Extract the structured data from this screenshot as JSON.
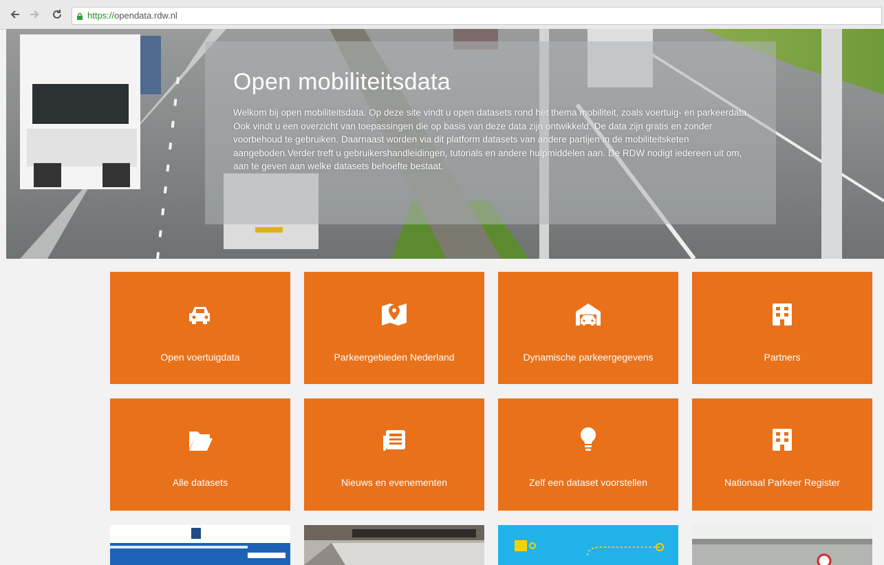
{
  "browser": {
    "url_protocol": "https://",
    "url_host": "opendata.rdw.nl",
    "back_icon": "back-arrow-icon",
    "forward_icon": "forward-arrow-icon",
    "reload_icon": "reload-icon",
    "lock_icon": "lock-icon"
  },
  "hero": {
    "title": "Open mobiliteitsdata",
    "text": "Welkom bij open mobiliteitsdata. Op deze site vindt u open datasets rond het thema mobiliteit, zoals voertuig- en parkeerdata. Ook vindt u een overzicht van toepassingen die op basis van deze data zijn ontwikkeld. De data zijn gratis en zonder voorbehoud te gebruiken. Daarnaast worden via dit platform datasets van andere partijen in de mobiliteitsketen aangeboden.Verder treft u gebruikershandleidingen, tutorials en andere hulpmiddelen aan. De RDW nodigt iedereen uit om, aan te geven aan welke datasets behoefte bestaat."
  },
  "colors": {
    "tile": "#e8711a",
    "page_background": "#f2f2f2",
    "url_protocol": "#1e8f1e"
  },
  "tiles": [
    {
      "label": "Open voertuigdata",
      "icon": "car-icon"
    },
    {
      "label": "Parkeergebieden Nederland",
      "icon": "map-pin-icon"
    },
    {
      "label": "Dynamische parkeergegevens",
      "icon": "garage-car-icon"
    },
    {
      "label": "Partners",
      "icon": "building-icon"
    },
    {
      "label": "Alle datasets",
      "icon": "folder-open-icon"
    },
    {
      "label": "Nieuws en evenementen",
      "icon": "newspaper-icon"
    },
    {
      "label": "Zelf een dataset voorstellen",
      "icon": "lightbulb-icon"
    },
    {
      "label": "Nationaal Parkeer Register",
      "icon": "building-icon"
    }
  ]
}
